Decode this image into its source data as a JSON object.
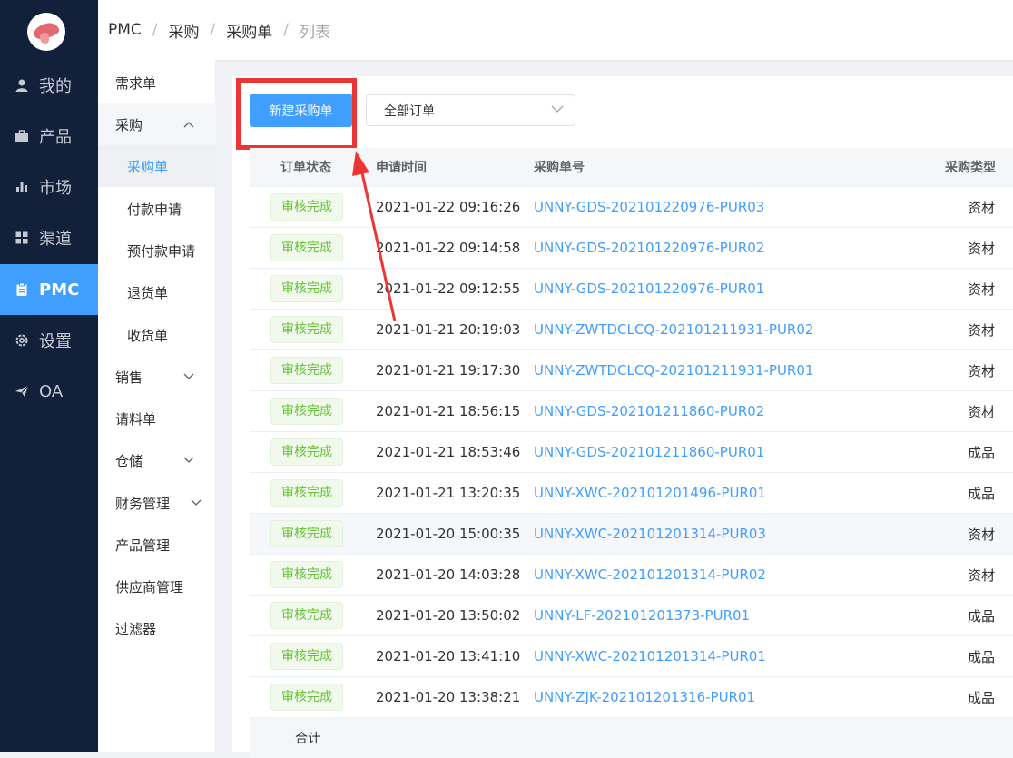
{
  "nav": {
    "items": [
      {
        "label": "我的",
        "icon": "user-icon"
      },
      {
        "label": "产品",
        "icon": "briefcase-icon"
      },
      {
        "label": "市场",
        "icon": "bar-chart-icon"
      },
      {
        "label": "渠道",
        "icon": "grid-icon"
      },
      {
        "label": "PMC",
        "icon": "clipboard-icon",
        "active": true
      },
      {
        "label": "设置",
        "icon": "gear-icon"
      },
      {
        "label": "OA",
        "icon": "send-icon"
      }
    ]
  },
  "breadcrumb": {
    "items": [
      "PMC",
      "采购",
      "采购单",
      "列表"
    ],
    "separator": "/"
  },
  "submenu": {
    "items": [
      {
        "label": "需求单"
      },
      {
        "label": "采购",
        "chevron": "up"
      },
      {
        "label": "采购单",
        "active": true
      },
      {
        "label": "付款申请"
      },
      {
        "label": "预付款申请"
      },
      {
        "label": "退货单"
      },
      {
        "label": "收货单"
      },
      {
        "label": "销售",
        "chevron": "down"
      },
      {
        "label": "请料单"
      },
      {
        "label": "仓储",
        "chevron": "down"
      },
      {
        "label": "财务管理",
        "chevron": "down"
      },
      {
        "label": "产品管理"
      },
      {
        "label": "供应商管理"
      },
      {
        "label": "过滤器"
      }
    ]
  },
  "toolbar": {
    "new_button_label": "新建采购单",
    "filter_value": "全部订单"
  },
  "table": {
    "headers": {
      "status": "订单状态",
      "time": "申请时间",
      "no": "采购单号",
      "type": "采购类型"
    },
    "rows": [
      {
        "status": "审核完成",
        "time": "2021-01-22 09:16:26",
        "no": "UNNY-GDS-202101220976-PUR03",
        "type": "资材"
      },
      {
        "status": "审核完成",
        "time": "2021-01-22 09:14:58",
        "no": "UNNY-GDS-202101220976-PUR02",
        "type": "资材"
      },
      {
        "status": "审核完成",
        "time": "2021-01-22 09:12:55",
        "no": "UNNY-GDS-202101220976-PUR01",
        "type": "资材"
      },
      {
        "status": "审核完成",
        "time": "2021-01-21 20:19:03",
        "no": "UNNY-ZWTDCLCQ-202101211931-PUR02",
        "type": "资材"
      },
      {
        "status": "审核完成",
        "time": "2021-01-21 19:17:30",
        "no": "UNNY-ZWTDCLCQ-202101211931-PUR01",
        "type": "资材"
      },
      {
        "status": "审核完成",
        "time": "2021-01-21 18:56:15",
        "no": "UNNY-GDS-202101211860-PUR02",
        "type": "资材"
      },
      {
        "status": "审核完成",
        "time": "2021-01-21 18:53:46",
        "no": "UNNY-GDS-202101211860-PUR01",
        "type": "成品"
      },
      {
        "status": "审核完成",
        "time": "2021-01-21 13:20:35",
        "no": "UNNY-XWC-202101201496-PUR01",
        "type": "成品"
      },
      {
        "status": "审核完成",
        "time": "2021-01-20 15:00:35",
        "no": "UNNY-XWC-202101201314-PUR03",
        "type": "资材"
      },
      {
        "status": "审核完成",
        "time": "2021-01-20 14:03:28",
        "no": "UNNY-XWC-202101201314-PUR02",
        "type": "资材"
      },
      {
        "status": "审核完成",
        "time": "2021-01-20 13:50:02",
        "no": "UNNY-LF-202101201373-PUR01",
        "type": "成品"
      },
      {
        "status": "审核完成",
        "time": "2021-01-20 13:41:10",
        "no": "UNNY-XWC-202101201314-PUR01",
        "type": "成品"
      },
      {
        "status": "审核完成",
        "time": "2021-01-20 13:38:21",
        "no": "UNNY-ZJK-202101201316-PUR01",
        "type": "成品"
      }
    ],
    "footer_label": "合计"
  },
  "colors": {
    "nav_bg": "#13203a",
    "accent": "#409eff",
    "status_green": "#67c23a",
    "annotation_red": "#ee3535"
  }
}
